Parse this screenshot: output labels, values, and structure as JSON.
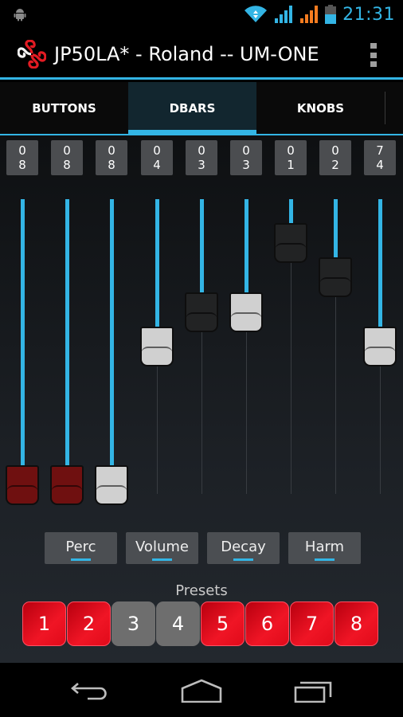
{
  "status_bar": {
    "time": "21:31",
    "icons": [
      "android-icon",
      "wifi-icon",
      "signal-blue-icon",
      "signal-orange-icon",
      "battery-icon"
    ]
  },
  "action_bar": {
    "title": "JP50LA* - Roland -- UM-ONE",
    "app_icon": "triskelion-logo-icon",
    "overflow_icon": "overflow-menu-icon"
  },
  "tabs": [
    {
      "label": "BUTTONS",
      "active": false
    },
    {
      "label": "DBARS",
      "active": true
    },
    {
      "label": "KNOBS",
      "active": false
    }
  ],
  "drawbars": [
    {
      "top": "0",
      "bottom": "8",
      "value": 8,
      "color": "red"
    },
    {
      "top": "0",
      "bottom": "8",
      "value": 8,
      "color": "red"
    },
    {
      "top": "0",
      "bottom": "8",
      "value": 8,
      "color": "white"
    },
    {
      "top": "0",
      "bottom": "4",
      "value": 4,
      "color": "white"
    },
    {
      "top": "0",
      "bottom": "3",
      "value": 3,
      "color": "black"
    },
    {
      "top": "0",
      "bottom": "3",
      "value": 3,
      "color": "white"
    },
    {
      "top": "0",
      "bottom": "1",
      "value": 1,
      "color": "black"
    },
    {
      "top": "0",
      "bottom": "2",
      "value": 2,
      "color": "black"
    },
    {
      "top": "7",
      "bottom": "4",
      "value": 4,
      "color": "white"
    }
  ],
  "drawbar_max": 8,
  "function_buttons": [
    {
      "label": "Perc"
    },
    {
      "label": "Volume"
    },
    {
      "label": "Decay"
    },
    {
      "label": "Harm"
    }
  ],
  "presets": {
    "label": "Presets",
    "items": [
      {
        "label": "1",
        "on": true
      },
      {
        "label": "2",
        "on": true
      },
      {
        "label": "3",
        "on": false
      },
      {
        "label": "4",
        "on": false
      },
      {
        "label": "5",
        "on": true
      },
      {
        "label": "6",
        "on": true
      },
      {
        "label": "7",
        "on": true
      },
      {
        "label": "8",
        "on": true
      }
    ]
  },
  "colors": {
    "accent": "#33b5e5",
    "preset_on": "#e8101f",
    "preset_off": "#6e6e6e",
    "handle_red": "#6f1010",
    "handle_white": "#d0d0d0",
    "handle_black": "#222324"
  },
  "nav_bar": {
    "buttons": [
      "back-icon",
      "home-icon",
      "recents-icon"
    ]
  }
}
